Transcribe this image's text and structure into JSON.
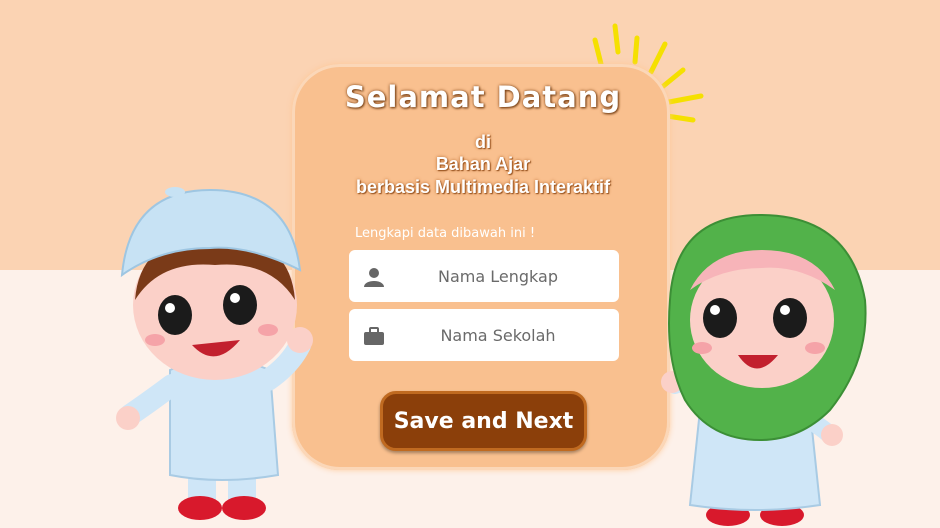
{
  "welcome": {
    "title": "Selamat Datang",
    "line1": "di",
    "line2": "Bahan Ajar",
    "line3": "berbasis Multimedia Interaktif"
  },
  "form": {
    "hint": "Lengkapi data dibawah ini !",
    "name_placeholder": "Nama Lengkap",
    "name_value": "",
    "school_placeholder": "Nama Sekolah",
    "school_value": "",
    "submit_label": "Save and Next"
  },
  "colors": {
    "bg_top": "#fbd3b3",
    "card": "#f9c08f",
    "button": "#8b3f0a"
  },
  "icons": {
    "name_field": "user-icon",
    "school_field": "briefcase-icon"
  }
}
